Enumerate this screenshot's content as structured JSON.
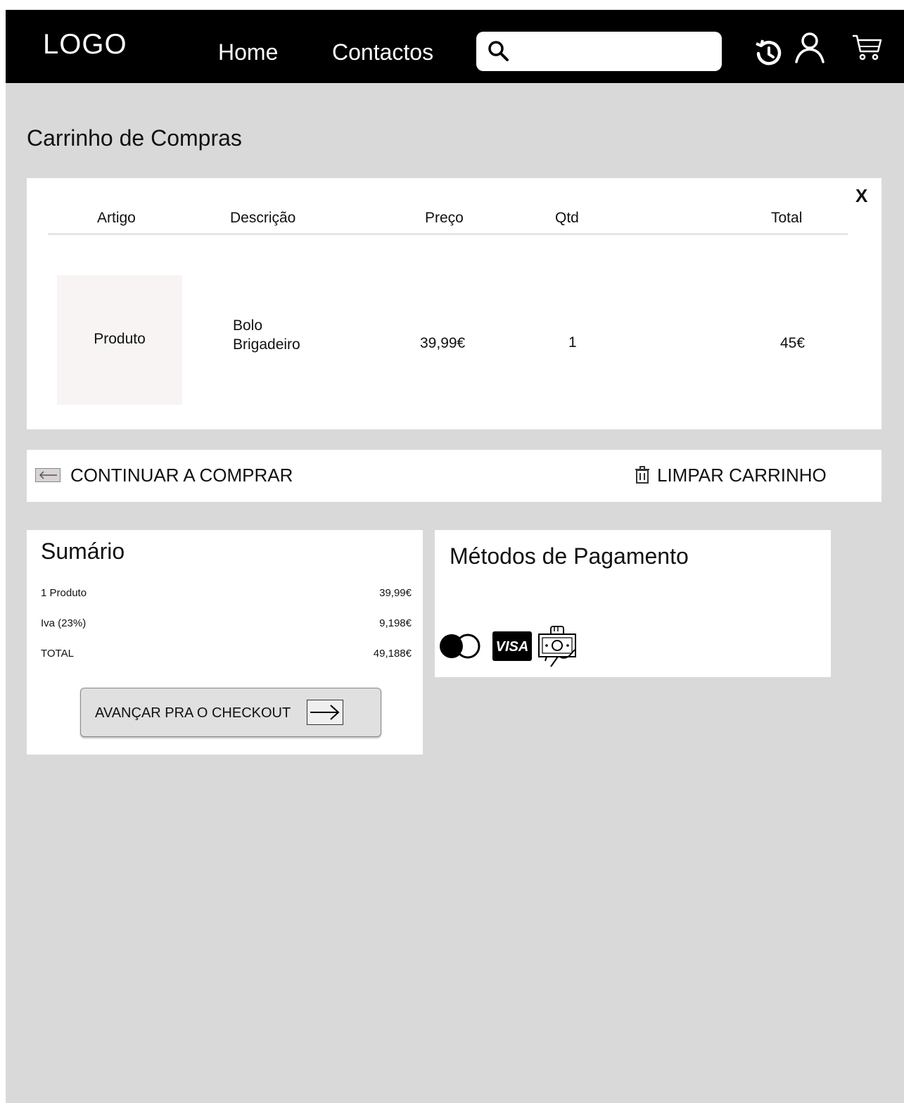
{
  "header": {
    "logo": "LOGO",
    "nav": {
      "home": "Home",
      "contacts": "Contactos"
    },
    "search": {
      "value": "",
      "placeholder": ""
    },
    "icons": [
      "history-icon",
      "user-icon",
      "cart-icon"
    ]
  },
  "page": {
    "title": "Carrinho de Compras"
  },
  "cart": {
    "close_label": "X",
    "columns": {
      "item": "Artigo",
      "description": "Descrição",
      "price": "Preço",
      "qty": "Qtd",
      "total": "Total"
    },
    "rows": [
      {
        "image_label": "Produto",
        "description_line1": "Bolo",
        "description_line2": "Brigadeiro",
        "price": "39,99€",
        "qty": "1",
        "total": "45€"
      }
    ]
  },
  "actions": {
    "continue_label": "CONTINUAR A COMPRAR",
    "clear_label": "LIMPAR CARRINHO"
  },
  "summary": {
    "title": "Sumário",
    "lines": [
      {
        "label": "1 Produto",
        "value": "39,99€"
      },
      {
        "label": "Iva (23%)",
        "value": "9,198€"
      },
      {
        "label": "TOTAL",
        "value": "49,188€"
      }
    ],
    "checkout_label": "AVANÇAR PRA O CHECKOUT"
  },
  "payment": {
    "title": "Métodos de Pagamento",
    "methods": [
      "mastercard-icon",
      "visa-icon",
      "cash-icon"
    ],
    "visa_text": "VISA"
  },
  "colors": {
    "header_bg": "#000000",
    "page_bg": "#d9d9d9",
    "panel_bg": "#ffffff",
    "product_placeholder": "#f7f4f3"
  }
}
